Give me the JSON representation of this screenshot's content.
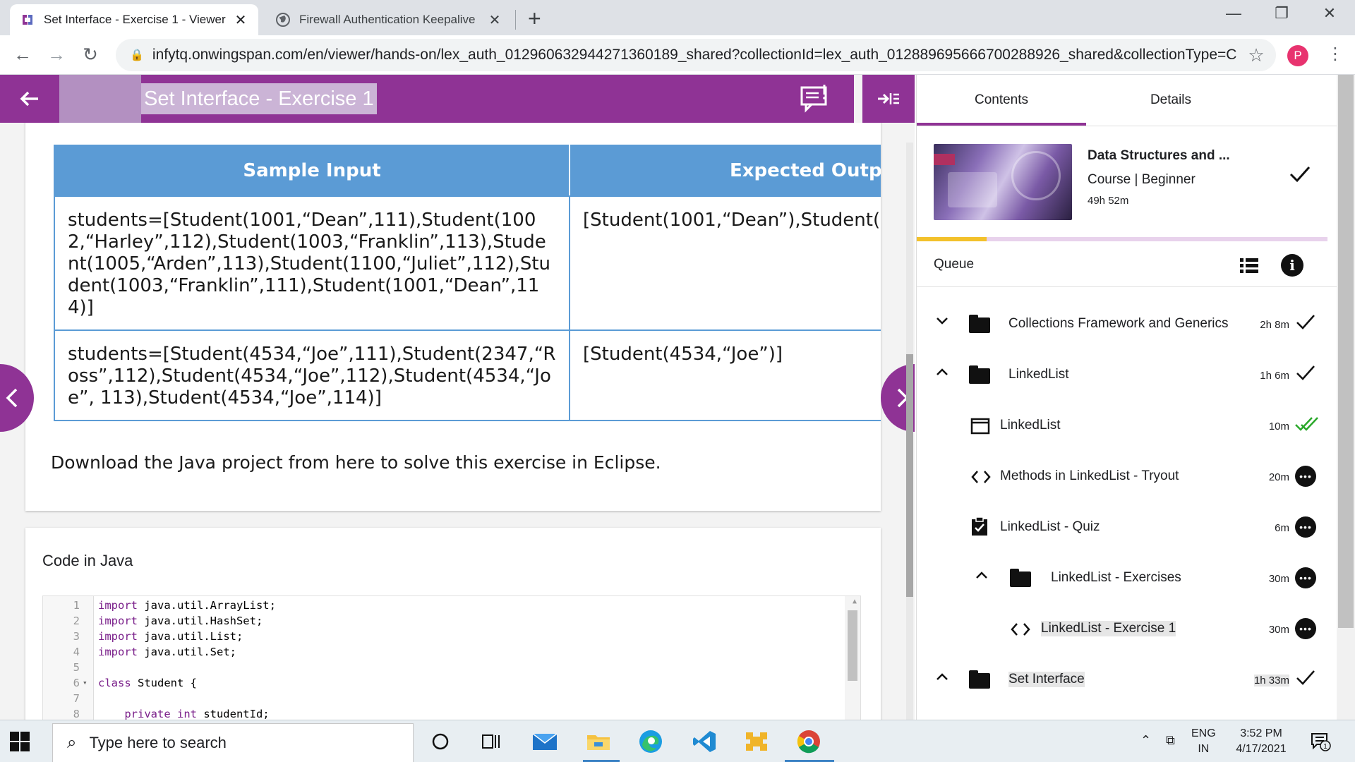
{
  "browser": {
    "tabs": [
      {
        "title": "Set Interface - Exercise 1 - Viewer",
        "active": true
      },
      {
        "title": "Firewall Authentication Keepalive",
        "active": false
      }
    ],
    "url": "infytq.onwingspan.com/en/viewer/hands-on/lex_auth_01296063294427136018​9_shared?collectionId=lex_auth_012889695666700288926_shared&collectionType=C...",
    "profile_initial": "P"
  },
  "viewer": {
    "title": "Set Interface - Exercise 1",
    "table": {
      "headers": [
        "Sample Input",
        "Expected Outpu"
      ],
      "rows": [
        [
          "students=[Student(1001,“Dean”,111),Student(1002,“Harley”,112),Student(1003,“Franklin”,113),Student(1005,“Arden”,113),Student(1100,“Juliet”,112),Student(1003,“Franklin”,111),Student(1001,“Dean”,114)]",
          "[Student(1001,“Dean”),Student("
        ],
        [
          "students=[Student(4534,“Joe”,111),Student(2347,“Ross”,112),Student(4534,“Joe”,112),Student(4534,“Joe”, 113),Student(4534,“Joe”,114)]",
          "[Student(4534,“Joe”)]"
        ]
      ]
    },
    "download_text": "Download the Java project from here to solve this exercise in Eclipse.",
    "code_title": "Code in Java",
    "code_lines": [
      {
        "n": "1",
        "kw": "import",
        "rest": " java.util.ArrayList;"
      },
      {
        "n": "2",
        "kw": "import",
        "rest": " java.util.HashSet;"
      },
      {
        "n": "3",
        "kw": "import",
        "rest": " java.util.List;"
      },
      {
        "n": "4",
        "kw": "import",
        "rest": " java.util.Set;"
      },
      {
        "n": "5",
        "kw": "",
        "rest": ""
      },
      {
        "n": "6",
        "kw": "class",
        "rest": " Student {",
        "fold": true
      },
      {
        "n": "7",
        "kw": "",
        "rest": ""
      },
      {
        "n": "8",
        "kw": "    private int",
        "rest": " studentId;"
      }
    ]
  },
  "panel": {
    "tabs": [
      "Contents",
      "Details"
    ],
    "active_tab": "Contents",
    "course": {
      "title": "Data Structures and ...",
      "meta": "Course |  Beginner",
      "duration": "49h 52m",
      "progress": 0.17
    },
    "queue_label": "Queue",
    "queue": [
      {
        "label": "Collections Framework and Generics",
        "dur": "2h 8m",
        "icon": "folder-icon",
        "chev": "down",
        "status": "check",
        "indent": 0
      },
      {
        "label": "LinkedList",
        "dur": "1h 6m",
        "icon": "folder-icon",
        "chev": "up",
        "status": "check",
        "indent": 0
      },
      {
        "label": "LinkedList",
        "dur": "10m",
        "icon": "window-icon",
        "chev": "",
        "status": "double-check",
        "indent": 1
      },
      {
        "label": "Methods in LinkedList - Tryout",
        "dur": "20m",
        "icon": "code-icon",
        "chev": "",
        "status": "more",
        "indent": 1
      },
      {
        "label": "LinkedList - Quiz",
        "dur": "6m",
        "icon": "quiz-icon",
        "chev": "",
        "status": "more",
        "indent": 1
      },
      {
        "label": "LinkedList - Exercises",
        "dur": "30m",
        "icon": "folder-icon",
        "chev": "up",
        "status": "more",
        "indent": 2
      },
      {
        "label": "LinkedList - Exercise 1",
        "dur": "30m",
        "icon": "code-icon",
        "chev": "",
        "status": "more",
        "indent": 3
      },
      {
        "label": "Set Interface",
        "dur": "1h 33m",
        "icon": "folder-icon",
        "chev": "up",
        "status": "check",
        "indent": 0
      }
    ]
  },
  "taskbar": {
    "search_placeholder": "Type here to search",
    "lang_top": "ENG",
    "lang_bottom": "IN",
    "time": "3:52 PM",
    "date": "4/17/2021",
    "notification_count": "1"
  },
  "colors": {
    "accent_purple": "#8f3395",
    "table_blue": "#5b9bd5",
    "progress_yellow": "#f3c12b",
    "done_green": "#2aa82a"
  }
}
